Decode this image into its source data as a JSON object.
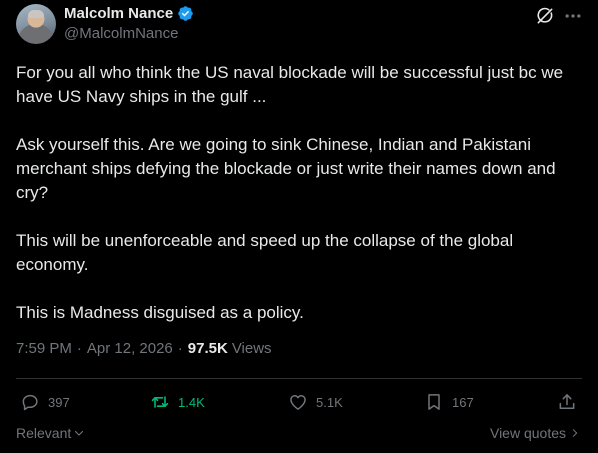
{
  "author": {
    "display_name": "Malcolm Nance",
    "handle": "@MalcolmNance",
    "verified": true
  },
  "tweet": {
    "paragraphs": [
      "For you all who think the US naval blockade will be successful just bc we have US Navy ships in the gulf ...",
      "Ask yourself this. Are we going to sink Chinese, Indian and Pakistani merchant ships defying the blockade or just write their names down and cry?",
      "This will be unenforceable and speed up the collapse of the global economy.",
      "This is Madness disguised as a policy."
    ],
    "time": "7:59 PM",
    "date": "Apr 12, 2026",
    "views_count": "97.5K",
    "views_label": "Views"
  },
  "actions": {
    "replies": "397",
    "reposts": "1.4K",
    "likes": "5.1K",
    "bookmarks": "167"
  },
  "footer": {
    "sort_label": "Relevant",
    "view_quotes_label": "View quotes"
  },
  "colors": {
    "background": "#000000",
    "text": "#e7e9ea",
    "muted": "#71767b",
    "verified_blue": "#1d9bf0",
    "repost_green": "#00ba7c",
    "divider": "#2f3336"
  },
  "icons": {
    "header": [
      "grok-icon",
      "more-icon"
    ],
    "actions": [
      "reply-icon",
      "repost-icon",
      "like-icon",
      "bookmark-icon",
      "share-icon"
    ]
  }
}
